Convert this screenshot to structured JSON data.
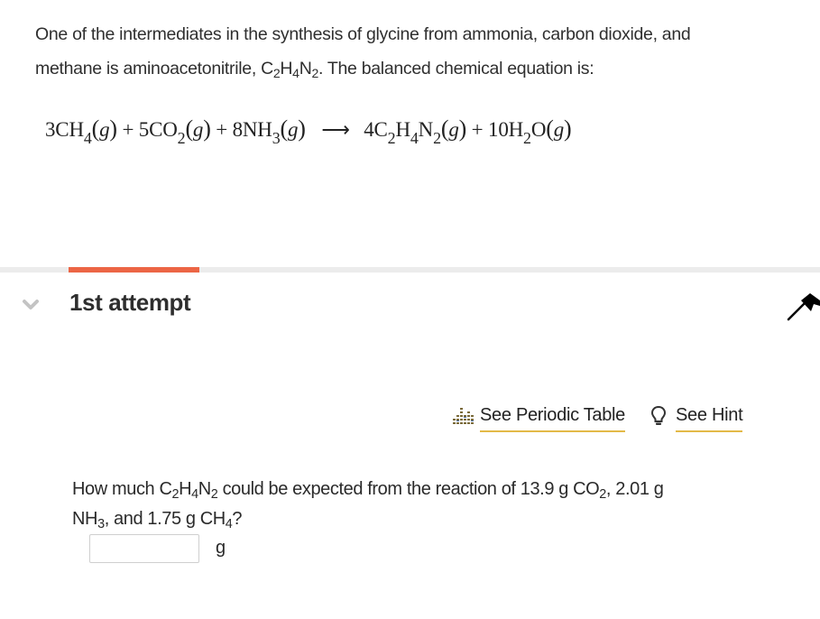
{
  "intro": {
    "line1": "One of the intermediates in the synthesis of glycine from ammonia, carbon dioxide, and",
    "line2_prefix": "methane is aminoacetonitrile, ",
    "compound": {
      "c": "C",
      "c_sub": "2",
      "h": "H",
      "h_sub": "4",
      "n": "N",
      "n_sub": "2"
    },
    "line2_suffix": ". The balanced chemical equation is:"
  },
  "equation": {
    "reactants": [
      {
        "coef": "3",
        "formula": [
          [
            "CH",
            ""
          ],
          [
            "",
            "4"
          ]
        ],
        "state": "g"
      },
      {
        "coef": "5",
        "formula": [
          [
            "CO",
            ""
          ],
          [
            "",
            "2"
          ]
        ],
        "state": "g"
      },
      {
        "coef": "8",
        "formula": [
          [
            "NH",
            ""
          ],
          [
            "",
            "3"
          ]
        ],
        "state": "g"
      }
    ],
    "products": [
      {
        "coef": "4",
        "state": "g"
      },
      {
        "coef": "10",
        "state": "g"
      }
    ],
    "plus": "+",
    "arrow": "⟶",
    "t": {
      "r1": "3CH",
      "r1s": "4",
      "r2": "5CO",
      "r2s": "2",
      "r3": "8NH",
      "r3s": "3",
      "p1a": "4C",
      "p1as": "2",
      "p1b": "H",
      "p1bs": "4",
      "p1c": "N",
      "p1cs": "2",
      "p2a": "10H",
      "p2as": "2",
      "p2b": "O",
      "state": "g",
      "lp": "(",
      "rp": ")"
    }
  },
  "progress": {
    "fraction": 0.16,
    "color": "#ec6545",
    "track_color": "#ececec"
  },
  "attempt": {
    "title": "1st attempt",
    "toggle_icon": "chevron-down-icon"
  },
  "flag": {
    "icon": "flag-icon"
  },
  "links": {
    "periodic_table": {
      "label": "See Periodic Table",
      "icon": "periodic-table-icon"
    },
    "hint": {
      "label": "See Hint",
      "icon": "lightbulb-icon"
    },
    "underline_color": "#e3b948"
  },
  "question": {
    "p1": "How much ",
    "p2": " could be expected from the reaction of  13.9 g CO",
    "co2_sub": "2",
    "p3": ", 2.01 g",
    "p4": "NH",
    "nh3_sub": "3",
    "p5": ",  and 1.75 g CH",
    "ch4_sub": "4",
    "p6": "?"
  },
  "answer": {
    "value": "",
    "placeholder": "",
    "unit": "g"
  }
}
